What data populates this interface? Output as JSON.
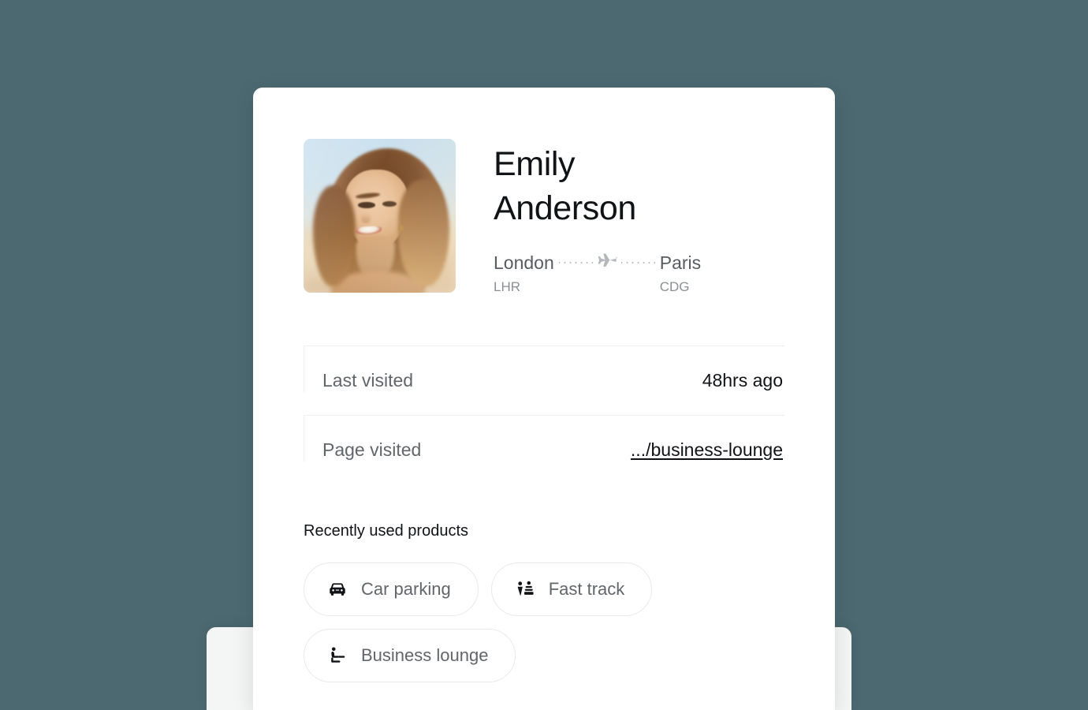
{
  "theme": {
    "background": "#4c6870",
    "card_background": "#ffffff",
    "card_behind_background": "#f4f5f5",
    "text_primary": "#111316",
    "text_secondary": "#61666b",
    "text_muted": "#8b9095",
    "border": "#ededee",
    "chip_border": "#e8e9ea"
  },
  "profile": {
    "name": "Emily Anderson",
    "avatar_alt": "Portrait photo of smiling woman with long brown hair at the beach",
    "avatar_icon": "user-photo"
  },
  "route": {
    "origin": {
      "city": "London",
      "code": "LHR"
    },
    "destination": {
      "city": "Paris",
      "code": "CDG"
    },
    "path_icon": "airplane-icon"
  },
  "details": [
    {
      "label": "Last visited",
      "value": "48hrs ago",
      "is_link": false
    },
    {
      "label": "Page visited",
      "value": ".../business-lounge",
      "is_link": true
    }
  ],
  "products": {
    "title": "Recently used products",
    "items": [
      {
        "label": "Car parking",
        "icon": "car-icon"
      },
      {
        "label": "Fast track",
        "icon": "fast-track-people-icon"
      },
      {
        "label": "Business lounge",
        "icon": "reclining-seat-icon"
      }
    ]
  }
}
